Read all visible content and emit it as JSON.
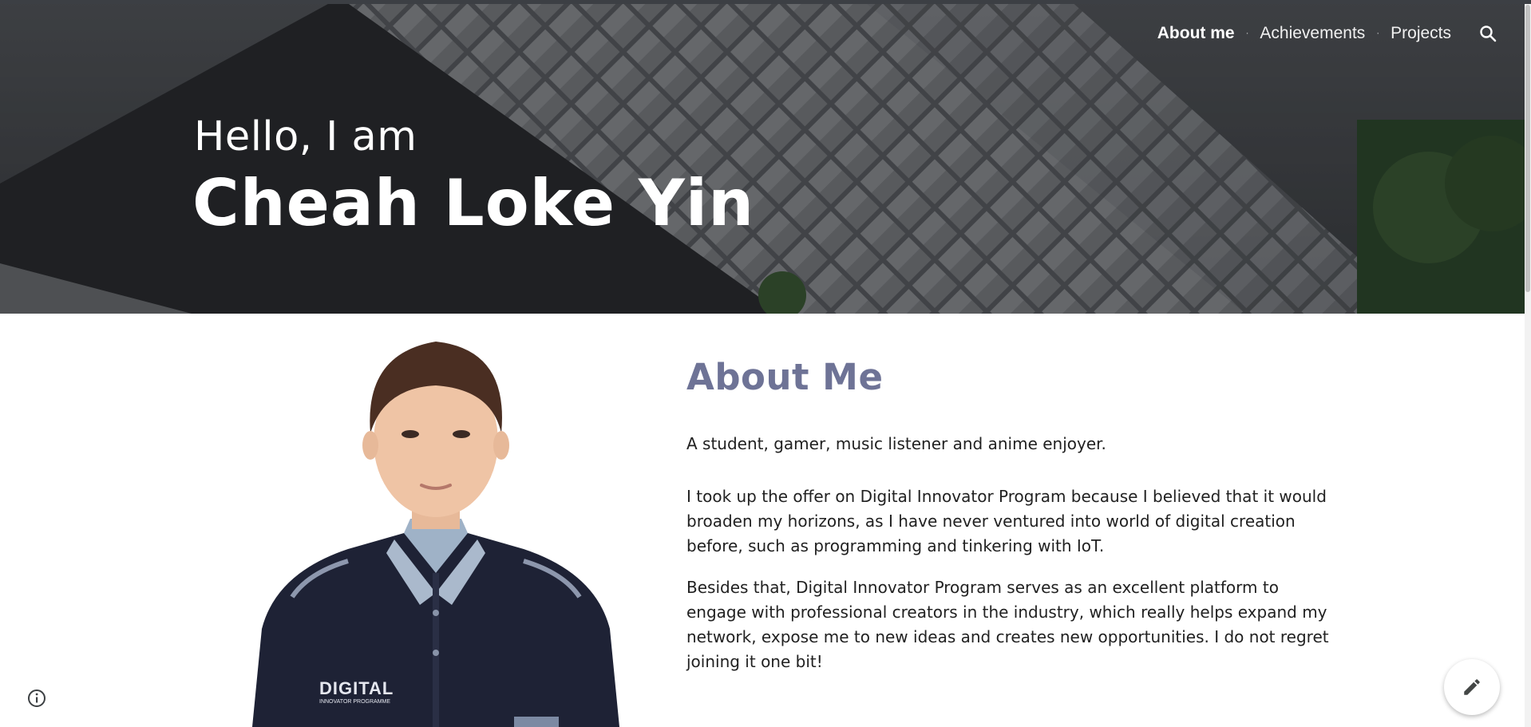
{
  "nav": {
    "items": [
      {
        "label": "About me",
        "active": true
      },
      {
        "label": "Achievements",
        "active": false
      },
      {
        "label": "Projects",
        "active": false
      }
    ],
    "search_icon": "search-icon"
  },
  "hero": {
    "greeting": "Hello, I am",
    "name": "Cheah Loke Yin"
  },
  "about": {
    "title": "About Me",
    "paragraphs": [
      "A student, gamer, music listener and anime enjoyer.",
      "I took up the offer on Digital Innovator Program because I believed that it would broaden my horizons, as I have never ventured into world of digital creation before, such as programming and tinkering with IoT.",
      "Besides that, Digital Innovator Program serves as an excellent platform to engage with professional creators in the industry, which really helps expand my network, expose me to new ideas and creates new opportunities. I do not regret joining it one bit!"
    ]
  },
  "portrait": {
    "badge_line1": "DIGITAL",
    "badge_line2": "INNOVATOR PROGRAMME"
  },
  "footer": {
    "info_icon": "info-icon",
    "edit_icon": "pencil-icon"
  },
  "colors": {
    "accent_heading": "#6e7396",
    "body_text": "#212121",
    "hero_text": "#ffffff"
  }
}
